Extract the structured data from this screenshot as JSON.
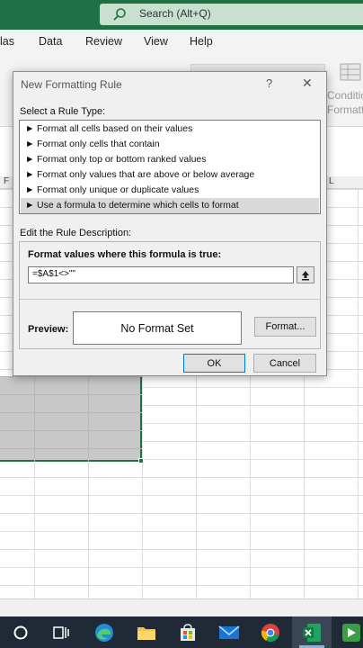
{
  "search": {
    "placeholder": "Search (Alt+Q)"
  },
  "ribbon_tabs": [
    {
      "label": "las"
    },
    {
      "label": "Data"
    },
    {
      "label": "Review"
    },
    {
      "label": "View"
    },
    {
      "label": "Help"
    }
  ],
  "ribbon_ghost": {
    "conditional_1": "Conditio",
    "conditional_2": "Formattin"
  },
  "columns": {
    "left": "F",
    "right": "L"
  },
  "dialog": {
    "title": "New Formatting Rule",
    "help": "?",
    "close": "✕",
    "select_rule_type_label": "Select a Rule Type:",
    "rule_types": [
      {
        "label": "Format all cells based on their values",
        "selected": false
      },
      {
        "label": "Format only cells that contain",
        "selected": false
      },
      {
        "label": "Format only top or bottom ranked values",
        "selected": false
      },
      {
        "label": "Format only values that are above or below average",
        "selected": false
      },
      {
        "label": "Format only unique or duplicate values",
        "selected": false
      },
      {
        "label": "Use a formula to determine which cells to format",
        "selected": true
      }
    ],
    "edit_description_label": "Edit the Rule Description:",
    "formula_label": "Format values where this formula is true:",
    "formula_value": "=$A$1<>\"\"",
    "preview_label": "Preview:",
    "preview_text": "No Format Set",
    "format_button": "Format...",
    "ok_button": "OK",
    "cancel_button": "Cancel"
  },
  "colors": {
    "title_bar": "#1e7145",
    "taskbar": "#1f2a36",
    "selection": "#c8c8c8"
  },
  "taskbar_icons": [
    "start-circle-icon",
    "task-view-icon",
    "edge-icon",
    "file-explorer-icon",
    "store-icon",
    "mail-icon",
    "chrome-icon",
    "excel-icon",
    "camtasia-icon"
  ]
}
